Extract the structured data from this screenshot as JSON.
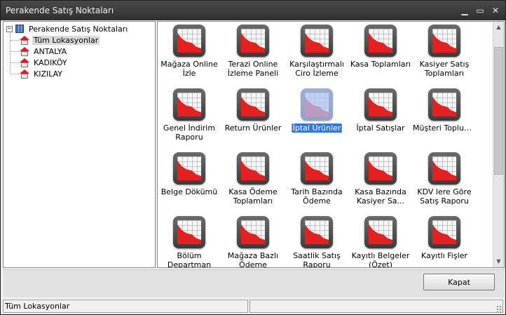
{
  "window": {
    "title": "Perakende Satış Noktaları",
    "minimize_icon": "minimize-icon",
    "maximize_icon": "maximize-icon",
    "close_icon": "close-icon"
  },
  "tree": {
    "root": {
      "label": "Perakende Satış Noktaları",
      "icon": "network-icon",
      "expander": "−"
    },
    "children": [
      {
        "label": "Tüm Lokasyonlar",
        "icon": "house-icon",
        "selected": true
      },
      {
        "label": "ANTALYA",
        "icon": "house-icon"
      },
      {
        "label": "KADIKÖY",
        "icon": "house-icon"
      },
      {
        "label": "KIZILAY",
        "icon": "house-icon"
      }
    ]
  },
  "reports": [
    {
      "label": "Mağaza Online İzle"
    },
    {
      "label": "Terazi Online İzleme Paneli"
    },
    {
      "label": "Karşılaştırmalı Ciro İzleme Paneli"
    },
    {
      "label": "Kasa Toplamları"
    },
    {
      "label": "Kasiyer Satış Toplamları"
    },
    {
      "label": "Genel İndirim Raporu"
    },
    {
      "label": "Return Ürünler"
    },
    {
      "label": "İptal Ürünler",
      "selected": true
    },
    {
      "label": "İptal Satışlar"
    },
    {
      "label": "Müşteri Topluml..."
    },
    {
      "label": "Belge Dökümü"
    },
    {
      "label": "Kasa Ödeme Toplamları"
    },
    {
      "label": "Tarih Bazında Ödeme Toplamları"
    },
    {
      "label": "Kasa Bazında Kasiyer Sa..."
    },
    {
      "label": "KDV lere Göre Satış Raporu"
    },
    {
      "label": "Bölüm Departman Satışları"
    },
    {
      "label": "Mağaza Bazlı Ödeme Toplamları"
    },
    {
      "label": "Saatlik Satış Raporu"
    },
    {
      "label": "Kayıtlı Belgeler (Özet)"
    },
    {
      "label": "Kayıtlı Fişler"
    }
  ],
  "buttons": {
    "close_label": "Kapat"
  },
  "status": {
    "left": "Tüm Lokasyonlar",
    "right": ""
  },
  "colors": {
    "titlebar": "#3a3a3a",
    "selection": "#3378e0",
    "chart_red": "#e52020"
  }
}
